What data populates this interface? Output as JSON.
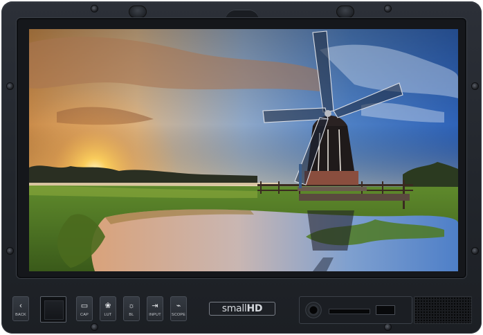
{
  "device": {
    "brand_prefix": "small",
    "brand_suffix": "HD"
  },
  "buttons": [
    {
      "label": "BACK",
      "icon": "back-arrow-icon",
      "glyph": "‹"
    },
    {
      "label": "CAP",
      "icon": "capture-icon",
      "glyph": "▭"
    },
    {
      "label": "LUT",
      "icon": "lut-icon",
      "glyph": "❀"
    },
    {
      "label": "BL",
      "icon": "brightness-icon",
      "glyph": "☼"
    },
    {
      "label": "INPUT",
      "icon": "input-icon",
      "glyph": "⇥"
    },
    {
      "label": "SCOPE",
      "icon": "waveform-icon",
      "glyph": "⌁"
    }
  ],
  "colors": {
    "bezel": "#22262c",
    "button_face": "#2f333a",
    "label": "#c9ccd1"
  }
}
